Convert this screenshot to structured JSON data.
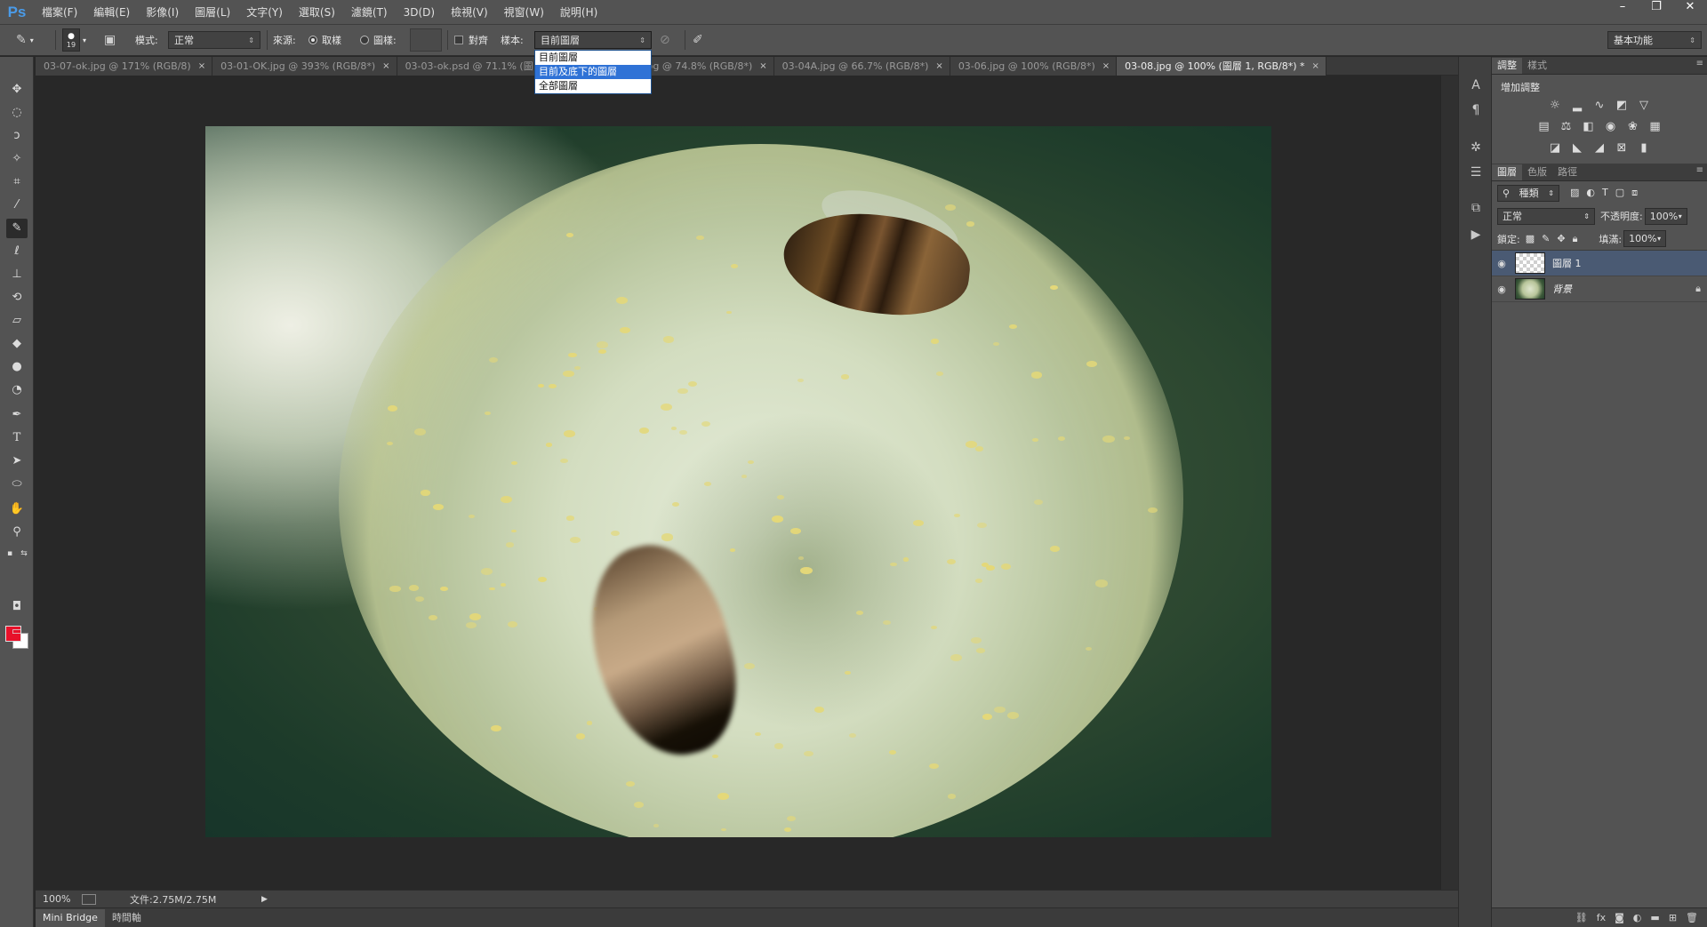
{
  "app": {
    "logo": "Ps",
    "menu": [
      "檔案(F)",
      "編輯(E)",
      "影像(I)",
      "圖層(L)",
      "文字(Y)",
      "選取(S)",
      "濾鏡(T)",
      "3D(D)",
      "檢視(V)",
      "視窗(W)",
      "說明(H)"
    ],
    "window_controls": [
      "–",
      "❐",
      "✕"
    ]
  },
  "options_bar": {
    "brush_size": "19",
    "mode_label": "模式:",
    "mode_value": "正常",
    "source_label": "來源:",
    "source_sampled": "取樣",
    "source_pattern": "圖樣:",
    "aligned_label": "對齊",
    "sample_label": "樣本:",
    "sample_value": "目前圖層",
    "workspace_value": "基本功能"
  },
  "sample_dropdown": {
    "options": [
      "目前圖層",
      "目前及底下的圖層",
      "全部圖層"
    ],
    "selected_index": 1
  },
  "tabs": [
    {
      "label": "03-07-ok.jpg @ 171% (RGB/8)",
      "active": false
    },
    {
      "label": "03-01-OK.jpg @ 393% (RGB/8*)",
      "active": false
    },
    {
      "label": "03-03-ok.psd @ 71.1% (圖",
      "active": false
    },
    {
      "label": "ok.jpg @ 74.8% (RGB/8*)",
      "active": false
    },
    {
      "label": "03-04A.jpg @ 66.7% (RGB/8*)",
      "active": false
    },
    {
      "label": "03-06.jpg @ 100% (RGB/8*)",
      "active": false
    },
    {
      "label": "03-08.jpg @ 100% (圖層 1, RGB/8*) *",
      "active": true
    }
  ],
  "status": {
    "zoom": "100%",
    "doc_info": "文件:2.75M/2.75M"
  },
  "bottom_tabs": [
    "Mini Bridge",
    "時間軸"
  ],
  "panels": {
    "adjust_tabs": [
      "調整",
      "樣式"
    ],
    "adjust_title": "增加調整",
    "layers_tabs": [
      "圖層",
      "色版",
      "路徑"
    ],
    "filter_kind": "種類",
    "blend_mode": "正常",
    "opacity_label": "不透明度:",
    "opacity_value": "100%",
    "lock_label": "鎖定:",
    "fill_label": "填滿:",
    "fill_value": "100%",
    "layers": [
      {
        "name": "圖層 1",
        "selected": true,
        "locked": false
      },
      {
        "name": "背景",
        "selected": false,
        "locked": true
      }
    ]
  },
  "colors": {
    "foreground": "#e8102a",
    "background": "#ffffff",
    "accent": "#2f72d6"
  }
}
